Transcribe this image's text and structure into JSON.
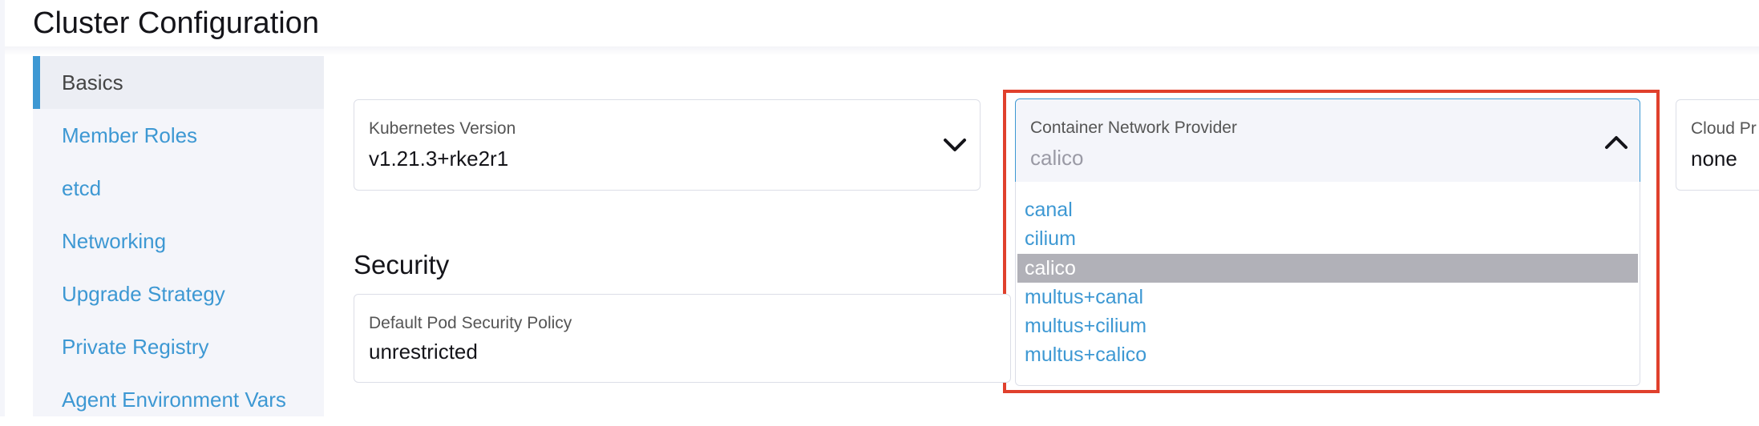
{
  "page": {
    "title": "Cluster Configuration"
  },
  "sidebar": {
    "items": [
      {
        "label": "Basics",
        "active": true
      },
      {
        "label": "Member Roles",
        "active": false
      },
      {
        "label": "etcd",
        "active": false
      },
      {
        "label": "Networking",
        "active": false
      },
      {
        "label": "Upgrade Strategy",
        "active": false
      },
      {
        "label": "Private Registry",
        "active": false
      },
      {
        "label": "Agent Environment Vars",
        "active": false
      }
    ]
  },
  "basics": {
    "kubernetes_version": {
      "label": "Kubernetes Version",
      "value": "v1.21.3+rke2r1",
      "icon": "chevron-down-icon"
    },
    "container_network_provider": {
      "label": "Container Network Provider",
      "value": "calico",
      "icon": "chevron-up-icon",
      "expanded": true,
      "options": [
        "canal",
        "cilium",
        "calico",
        "multus+canal",
        "multus+cilium",
        "multus+calico"
      ],
      "selected": "calico"
    },
    "cloud_provider": {
      "label": "Cloud Pr",
      "value": "none"
    }
  },
  "security": {
    "heading": "Security",
    "default_pod_security_policy": {
      "label": "Default Pod Security Policy",
      "value": "unrestricted"
    }
  },
  "colors": {
    "accent": "#3d98d3",
    "highlight": "#e0402c",
    "selected_option": "#b1b1b8",
    "sidebar_bg": "#f4f5fa"
  }
}
